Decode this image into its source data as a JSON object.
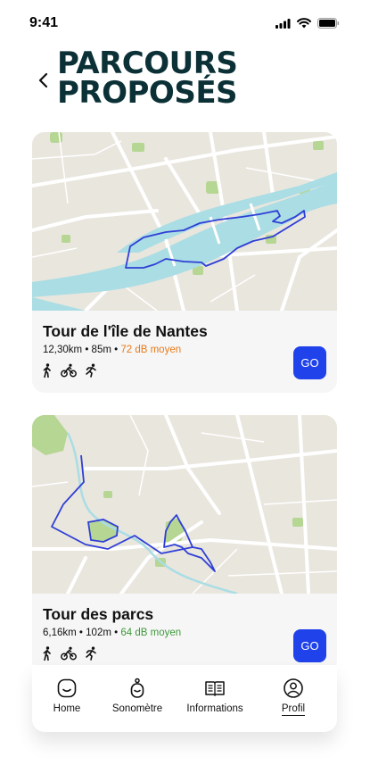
{
  "status": {
    "time": "9:41"
  },
  "header": {
    "title_line1": "PARCOURS",
    "title_line2": "PROPOSÉS"
  },
  "routes": [
    {
      "name": "Tour de l'île de Nantes",
      "distance": "12,30km",
      "elevation": "85m",
      "noise": "72 dB moyen",
      "noise_color": "#e87a1a",
      "go_label": "GO",
      "activities": [
        "walking-icon",
        "cycling-icon",
        "running-icon"
      ]
    },
    {
      "name": "Tour des parcs",
      "distance": "6,16km",
      "elevation": "102m",
      "noise": "64 dB moyen",
      "noise_color": "#3d9a3b",
      "go_label": "GO",
      "activities": [
        "walking-icon",
        "cycling-icon",
        "running-icon"
      ]
    }
  ],
  "stat_separator": "•",
  "nav": {
    "items": [
      {
        "label": "Home",
        "icon": "home-icon"
      },
      {
        "label": "Sonomètre",
        "icon": "sonometer-icon"
      },
      {
        "label": "Informations",
        "icon": "book-icon"
      },
      {
        "label": "Profil",
        "icon": "profile-icon",
        "active": true
      }
    ]
  },
  "colors": {
    "accent": "#2042ea",
    "title": "#0b3137",
    "route_line": "#2f3fd6",
    "water": "#aadde4",
    "park": "#b6d693",
    "map_bg": "#e9e6de"
  }
}
